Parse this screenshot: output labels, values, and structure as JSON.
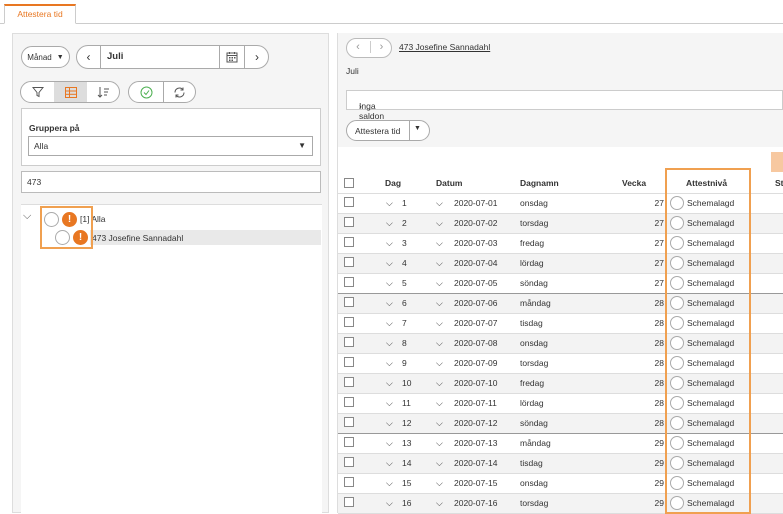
{
  "tabs": [
    {
      "label": "Attestera tid"
    }
  ],
  "left": {
    "period_select": "Månad",
    "month": "Juli",
    "group": {
      "label": "Gruppera på",
      "value": "Alla"
    },
    "search_value": "473",
    "tree": {
      "root": {
        "label": "[1] Alla"
      },
      "child": {
        "label": "473 Josefine Sannadahl"
      }
    }
  },
  "right": {
    "employee_link": "473 Josefine Sannadahl",
    "month_text": "Juli",
    "saldo_text": "Inga saldon",
    "attest_button": "Attestera tid",
    "columns": {
      "dag": "Dag",
      "datum": "Datum",
      "dagnamn": "Dagnamn",
      "vecka": "Vecka",
      "attestniva": "Attestnivå",
      "st": "St"
    },
    "rows": [
      {
        "dag": "1",
        "datum": "2020-07-01",
        "dagnamn": "onsdag",
        "vecka": "27",
        "status": "Schemalagd"
      },
      {
        "dag": "2",
        "datum": "2020-07-02",
        "dagnamn": "torsdag",
        "vecka": "27",
        "status": "Schemalagd"
      },
      {
        "dag": "3",
        "datum": "2020-07-03",
        "dagnamn": "fredag",
        "vecka": "27",
        "status": "Schemalagd"
      },
      {
        "dag": "4",
        "datum": "2020-07-04",
        "dagnamn": "lördag",
        "vecka": "27",
        "status": "Schemalagd"
      },
      {
        "dag": "5",
        "datum": "2020-07-05",
        "dagnamn": "söndag",
        "vecka": "27",
        "status": "Schemalagd"
      },
      {
        "dag": "6",
        "datum": "2020-07-06",
        "dagnamn": "måndag",
        "vecka": "28",
        "status": "Schemalagd"
      },
      {
        "dag": "7",
        "datum": "2020-07-07",
        "dagnamn": "tisdag",
        "vecka": "28",
        "status": "Schemalagd"
      },
      {
        "dag": "8",
        "datum": "2020-07-08",
        "dagnamn": "onsdag",
        "vecka": "28",
        "status": "Schemalagd"
      },
      {
        "dag": "9",
        "datum": "2020-07-09",
        "dagnamn": "torsdag",
        "vecka": "28",
        "status": "Schemalagd"
      },
      {
        "dag": "10",
        "datum": "2020-07-10",
        "dagnamn": "fredag",
        "vecka": "28",
        "status": "Schemalagd"
      },
      {
        "dag": "11",
        "datum": "2020-07-11",
        "dagnamn": "lördag",
        "vecka": "28",
        "status": "Schemalagd"
      },
      {
        "dag": "12",
        "datum": "2020-07-12",
        "dagnamn": "söndag",
        "vecka": "28",
        "status": "Schemalagd"
      },
      {
        "dag": "13",
        "datum": "2020-07-13",
        "dagnamn": "måndag",
        "vecka": "29",
        "status": "Schemalagd"
      },
      {
        "dag": "14",
        "datum": "2020-07-14",
        "dagnamn": "tisdag",
        "vecka": "29",
        "status": "Schemalagd"
      },
      {
        "dag": "15",
        "datum": "2020-07-15",
        "dagnamn": "onsdag",
        "vecka": "29",
        "status": "Schemalagd"
      },
      {
        "dag": "16",
        "datum": "2020-07-16",
        "dagnamn": "torsdag",
        "vecka": "29",
        "status": "Schemalagd"
      }
    ]
  },
  "colors": {
    "accent": "#e87722",
    "highlight_box": "#f0a050"
  }
}
